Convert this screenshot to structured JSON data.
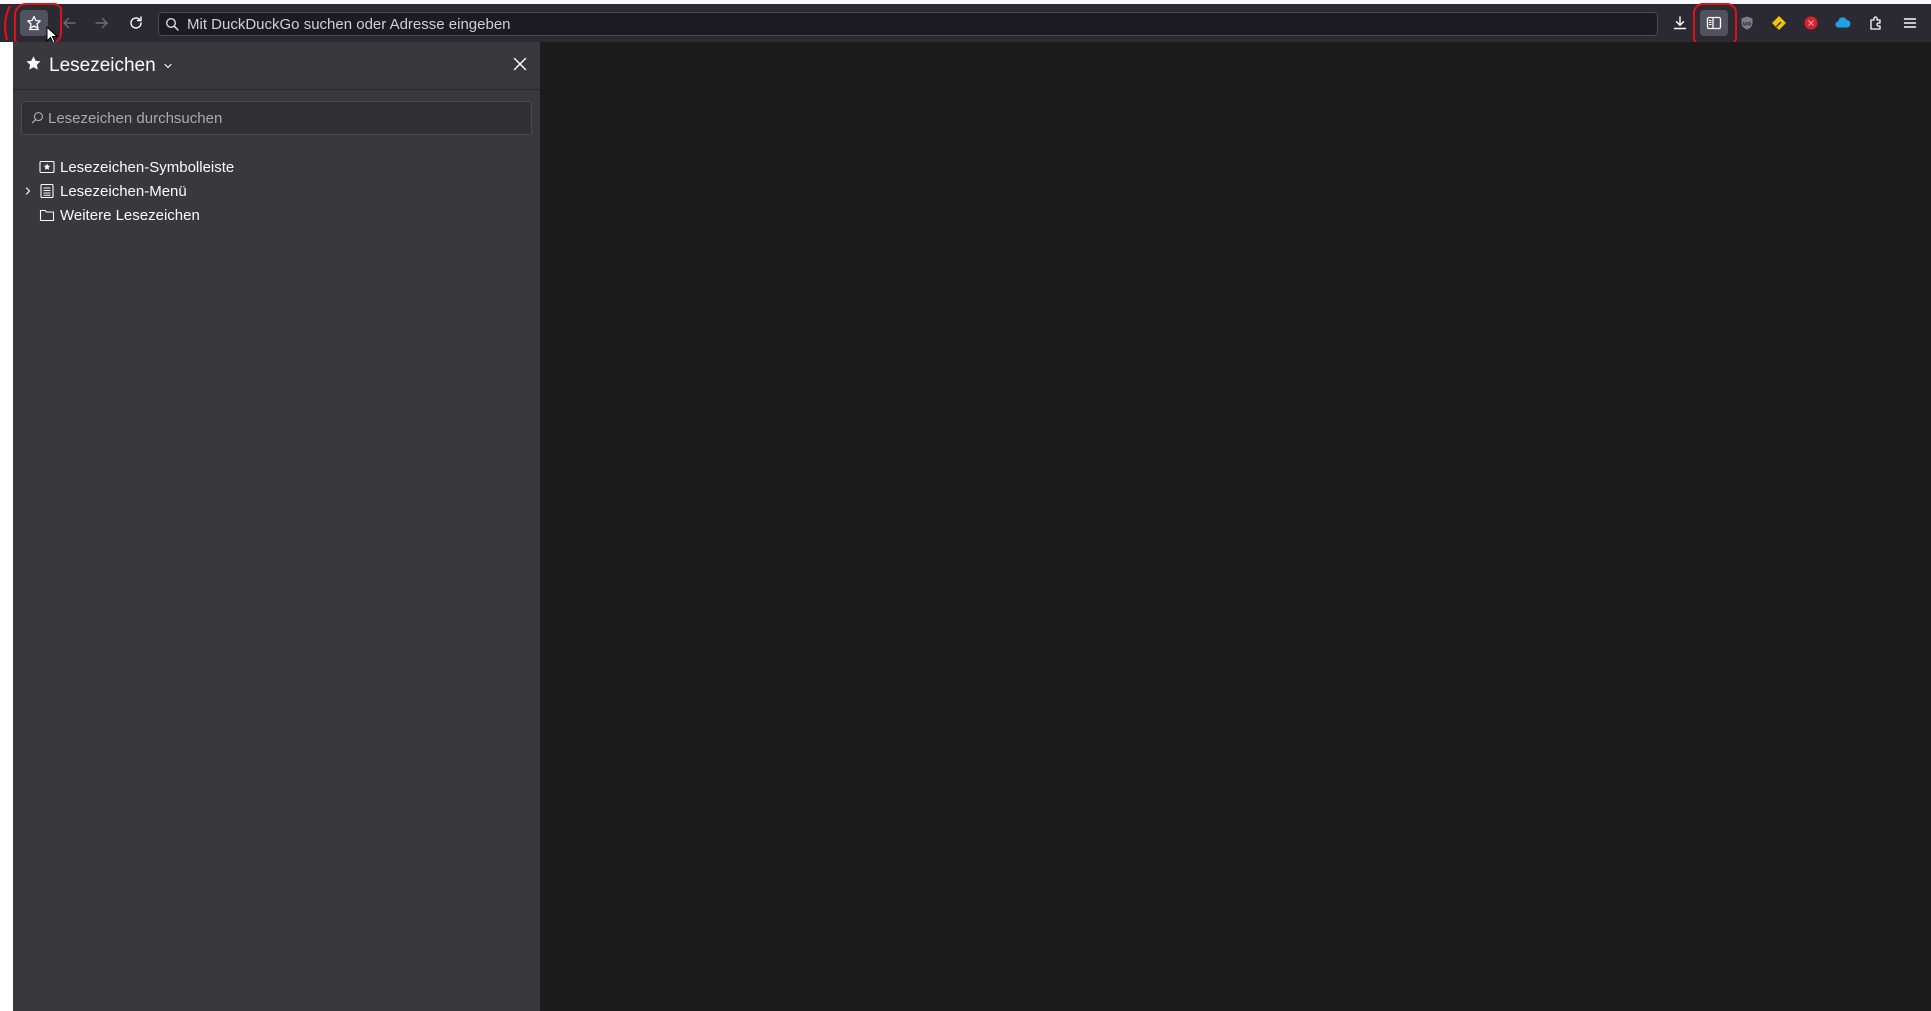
{
  "toolbar": {
    "urlbar_placeholder": "Mit DuckDuckGo suchen oder Adresse eingeben",
    "buttons": {
      "sidebar_bookmarks": "bookmarks-sidebar-icon",
      "back": "back-arrow-icon",
      "forward": "forward-arrow-icon",
      "reload": "reload-icon",
      "downloads": "download-icon",
      "sidebar_toggle": "sidebar-toggle-icon",
      "ext_ublock": "ublock-origin-icon",
      "ext_pencil": "pencil-extension-icon",
      "ext_red": "red-circle-extension-icon",
      "ext_cloud": "cloud-extension-icon",
      "extensions": "puzzle-extensions-icon",
      "menu": "hamburger-menu-icon"
    },
    "colors": {
      "toolbar_bg": "#2b2a33",
      "annotation": "#e0101a"
    }
  },
  "sidebar": {
    "title": "Lesezeichen",
    "search_placeholder": "Lesezeichen durchsuchen",
    "items": [
      {
        "label": "Lesezeichen-Symbolleiste",
        "icon": "bookmarks-toolbar-icon",
        "expandable": false
      },
      {
        "label": "Lesezeichen-Menü",
        "icon": "bookmarks-menu-icon",
        "expandable": true
      },
      {
        "label": "Weitere Lesezeichen",
        "icon": "folder-icon",
        "expandable": false
      }
    ]
  }
}
